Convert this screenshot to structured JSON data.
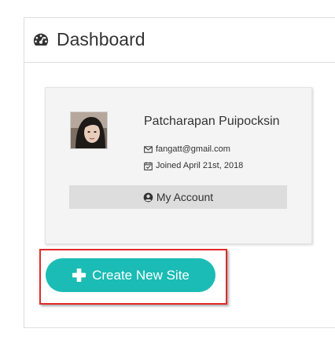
{
  "header": {
    "title": "Dashboard",
    "icon": "dashboard-gauge-icon"
  },
  "profile": {
    "name": "Patcharapan Puipocksin",
    "email": "fangatt@gmail.com",
    "email_icon": "envelope-icon",
    "joined": "Joined April 21st, 2018",
    "joined_icon": "calendar-check-icon",
    "account_button_label": "My Account",
    "account_icon": "user-circle-icon"
  },
  "actions": {
    "create_site_label": "Create New Site",
    "create_icon": "plus-icon"
  },
  "colors": {
    "accent": "#1bbcb5",
    "highlight": "#e12b2b",
    "card_bg": "#f4f4f4",
    "button_bg": "#dddddd"
  }
}
